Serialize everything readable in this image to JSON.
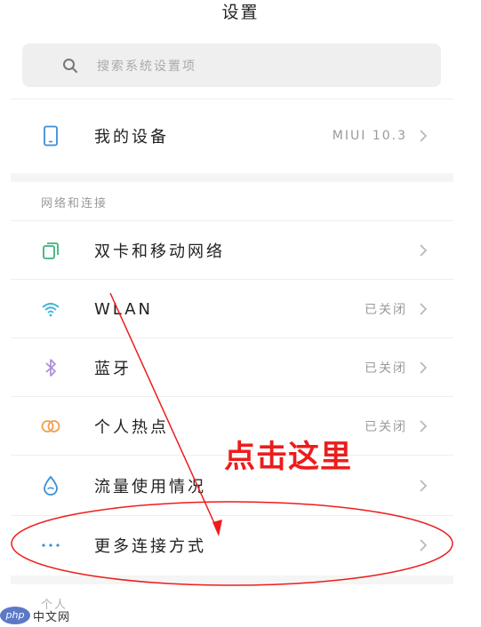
{
  "header": {
    "title": "设置"
  },
  "search": {
    "placeholder": "搜索系统设置项",
    "icon": "search-icon"
  },
  "device_row": {
    "label": "我的设备",
    "value": "MIUI 10.3",
    "icon": "phone-icon"
  },
  "network_section": {
    "header": "网络和连接",
    "items": [
      {
        "label": "双卡和移动网络",
        "value": "",
        "icon": "sim-cards-icon"
      },
      {
        "label": "WLAN",
        "value": "已关闭",
        "icon": "wifi-icon"
      },
      {
        "label": "蓝牙",
        "value": "已关闭",
        "icon": "bluetooth-icon"
      },
      {
        "label": "个人热点",
        "value": "已关闭",
        "icon": "hotspot-icon"
      },
      {
        "label": "流量使用情况",
        "value": "",
        "icon": "data-usage-icon"
      },
      {
        "label": "更多连接方式",
        "value": "",
        "icon": "more-icon"
      }
    ]
  },
  "personal_section": {
    "header": "个人"
  },
  "annotation": {
    "text": "点击这里",
    "color": "#ee1c1c"
  },
  "watermark": {
    "logo_text": "php",
    "text": "中文网"
  },
  "colors": {
    "accent_green": "#3bb27a",
    "accent_blue": "#3a8fd6",
    "accent_orange": "#f0a050",
    "wifi": "#3cb3d8",
    "bluetooth": "#a78bd6"
  }
}
